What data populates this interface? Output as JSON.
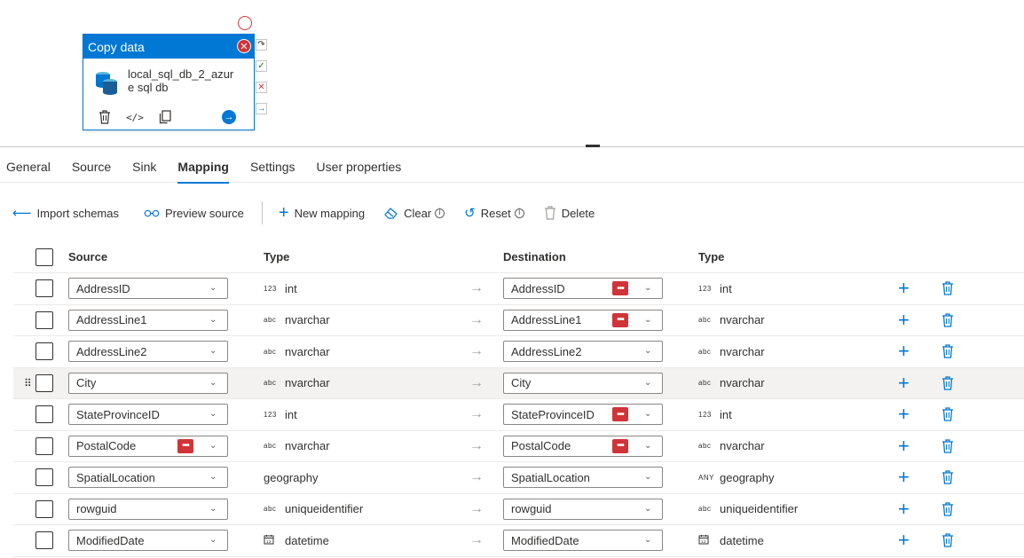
{
  "activity": {
    "title": "Copy data",
    "name": "local_sql_db_2_azure sql db"
  },
  "tabs": [
    {
      "label": "General"
    },
    {
      "label": "Source"
    },
    {
      "label": "Sink"
    },
    {
      "label": "Mapping",
      "active": true
    },
    {
      "label": "Settings"
    },
    {
      "label": "User properties"
    }
  ],
  "toolbar": {
    "import_schemas": "Import schemas",
    "preview_source": "Preview source",
    "new_mapping": "New mapping",
    "clear": "Clear",
    "reset": "Reset",
    "delete": "Delete"
  },
  "grid": {
    "headers": {
      "source": "Source",
      "source_type": "Type",
      "destination": "Destination",
      "dest_type": "Type"
    },
    "rows": [
      {
        "source": "AddressID",
        "source_type_prefix": "123",
        "source_type": "int",
        "dest": "AddressID",
        "dest_badge": true,
        "dest_type_prefix": "123",
        "dest_type": "int"
      },
      {
        "source": "AddressLine1",
        "source_type_prefix": "abc",
        "source_type": "nvarchar",
        "dest": "AddressLine1",
        "dest_badge": true,
        "dest_type_prefix": "abc",
        "dest_type": "nvarchar"
      },
      {
        "source": "AddressLine2",
        "source_type_prefix": "abc",
        "source_type": "nvarchar",
        "dest": "AddressLine2",
        "dest_badge": false,
        "dest_type_prefix": "abc",
        "dest_type": "nvarchar"
      },
      {
        "source": "City",
        "source_type_prefix": "abc",
        "source_type": "nvarchar",
        "dest": "City",
        "dest_badge": false,
        "dest_type_prefix": "abc",
        "dest_type": "nvarchar"
      },
      {
        "source": "StateProvinceID",
        "source_type_prefix": "123",
        "source_type": "int",
        "dest": "StateProvinceID",
        "dest_badge": true,
        "dest_type_prefix": "123",
        "dest_type": "int"
      },
      {
        "source": "PostalCode",
        "source_badge": true,
        "source_type_prefix": "abc",
        "source_type": "nvarchar",
        "dest": "PostalCode",
        "dest_badge": true,
        "dest_type_prefix": "abc",
        "dest_type": "nvarchar"
      },
      {
        "source": "SpatialLocation",
        "source_type_prefix": "",
        "source_type": "geography",
        "dest": "SpatialLocation",
        "dest_badge": false,
        "dest_type_prefix": "ANY",
        "dest_type": "geography"
      },
      {
        "source": "rowguid",
        "source_type_prefix": "abc",
        "source_type": "uniqueidentifier",
        "dest": "rowguid",
        "dest_badge": false,
        "dest_type_prefix": "abc",
        "dest_type": "uniqueidentifier"
      },
      {
        "source": "ModifiedDate",
        "source_type_prefix": "cal",
        "source_type": "datetime",
        "dest": "ModifiedDate",
        "dest_badge": false,
        "dest_type_prefix": "cal",
        "dest_type": "datetime"
      }
    ]
  },
  "colors": {
    "accent": "#0078d4",
    "error": "#d13438"
  }
}
